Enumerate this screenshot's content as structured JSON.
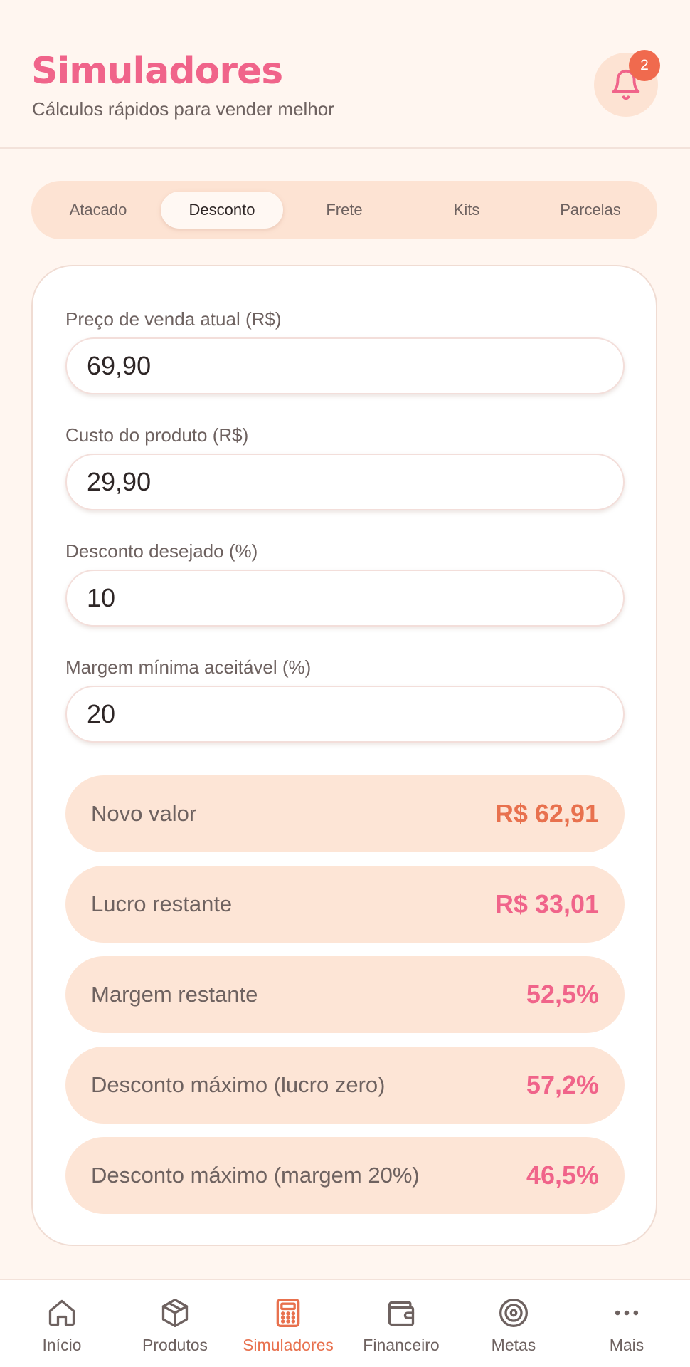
{
  "header": {
    "title": "Simuladores",
    "subtitle": "Cálculos rápidos para vender melhor",
    "notification_count": "2"
  },
  "tabs": [
    {
      "label": "Atacado",
      "active": false
    },
    {
      "label": "Desconto",
      "active": true
    },
    {
      "label": "Frete",
      "active": false
    },
    {
      "label": "Kits",
      "active": false
    },
    {
      "label": "Parcelas",
      "active": false
    }
  ],
  "form": {
    "price": {
      "label": "Preço de venda atual (R$)",
      "value": "69,90"
    },
    "cost": {
      "label": "Custo do produto (R$)",
      "value": "29,90"
    },
    "discount": {
      "label": "Desconto desejado (%)",
      "value": "10"
    },
    "min_margin": {
      "label": "Margem mínima aceitável (%)",
      "value": "20"
    }
  },
  "results": [
    {
      "label": "Novo valor",
      "value": "R$ 62,91",
      "color": "#E8714E"
    },
    {
      "label": "Lucro restante",
      "value": "R$ 33,01",
      "color": "#F0648A"
    },
    {
      "label": "Margem restante",
      "value": "52,5%",
      "color": "#F0648A"
    },
    {
      "label": "Desconto máximo (lucro zero)",
      "value": "57,2%",
      "color": "#F0648A"
    },
    {
      "label": "Desconto máximo (margem 20%)",
      "value": "46,5%",
      "color": "#F0648A"
    }
  ],
  "nav": [
    {
      "label": "Início",
      "icon": "home-icon",
      "active": false
    },
    {
      "label": "Produtos",
      "icon": "box-icon",
      "active": false
    },
    {
      "label": "Simuladores",
      "icon": "calculator-icon",
      "active": true
    },
    {
      "label": "Financeiro",
      "icon": "wallet-icon",
      "active": false
    },
    {
      "label": "Metas",
      "icon": "target-icon",
      "active": false
    },
    {
      "label": "Mais",
      "icon": "more-icon",
      "active": false
    }
  ],
  "colors": {
    "brand_pink": "#F0648A",
    "accent_orange": "#E8714E",
    "badge": "#F06A4E",
    "soft_peach": "#FDE3D3",
    "background": "#FFF6F0"
  }
}
